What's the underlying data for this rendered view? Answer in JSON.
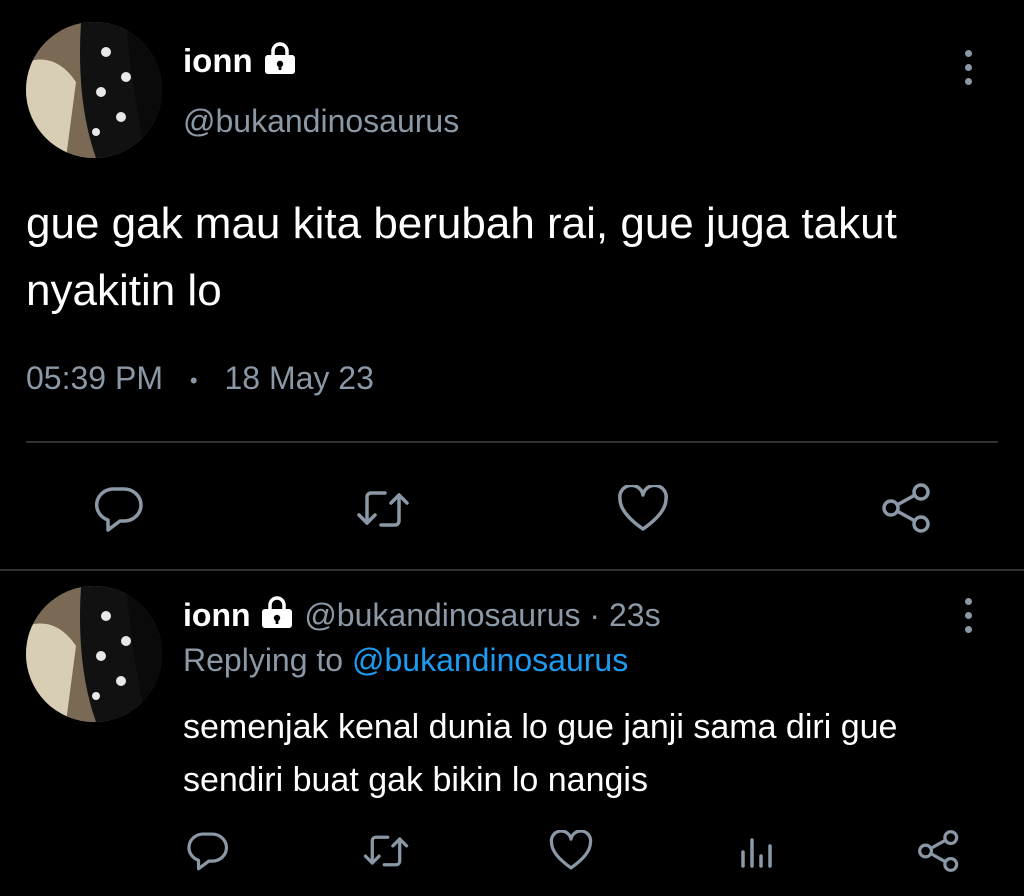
{
  "main_tweet": {
    "display_name": "ionn",
    "handle": "@bukandinosaurus",
    "text_line1": "gue gak mau kita berubah rai, gue juga takut",
    "text_line2": "nyakitin lo",
    "time": "05:39 PM",
    "separator": "•",
    "date": "18 May 23",
    "icons": [
      "lock-icon",
      "more-icon",
      "reply-icon",
      "retweet-icon",
      "like-icon",
      "share-icon"
    ]
  },
  "reply_tweet": {
    "display_name": "ionn",
    "handle_time": "@bukandinosaurus · 23s",
    "replying_prefix": "Replying to ",
    "replying_to": "@bukandinosaurus",
    "text_line1": "semenjak kenal dunia lo gue janji sama diri gue",
    "text_line2": "sendiri buat gak bikin lo nangis",
    "icons": [
      "reply-icon",
      "retweet-icon",
      "like-icon",
      "views-icon",
      "share-icon"
    ]
  },
  "colors": {
    "background": "#000000",
    "text": "#e7e9ea",
    "muted": "#8b98a5",
    "link": "#1d9bf0",
    "divider": "#2f3336"
  }
}
